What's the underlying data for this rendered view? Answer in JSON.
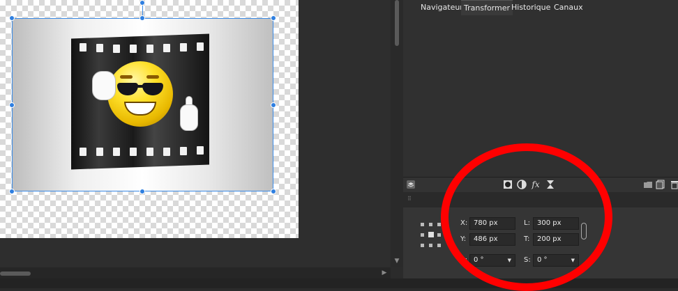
{
  "studio_toolbar": {
    "icons": [
      "layers-icon",
      "mask-icon",
      "adjustment-icon",
      "fx-icon",
      "hourglass-icon",
      "folder-icon",
      "copy-icon",
      "trash-icon"
    ],
    "fx_label": "fx"
  },
  "tabs": [
    {
      "label": "Navigateur",
      "active": false
    },
    {
      "label": "Transformer",
      "active": true
    },
    {
      "label": "Historique",
      "active": false
    },
    {
      "label": "Canaux",
      "active": false
    }
  ],
  "transform": {
    "x_label": "X:",
    "x_value": "780 px",
    "y_label": "Y:",
    "y_value": "486 px",
    "w_label": "L:",
    "w_value": "300 px",
    "h_label": "T:",
    "h_value": "200 px",
    "r_label": "R:",
    "r_value": "0 °",
    "s_label": "S:",
    "s_value": "0 °"
  },
  "colors": {
    "selection": "#3a8ae6",
    "annotation_ring": "#ff0000",
    "panel_bg": "#353535"
  }
}
